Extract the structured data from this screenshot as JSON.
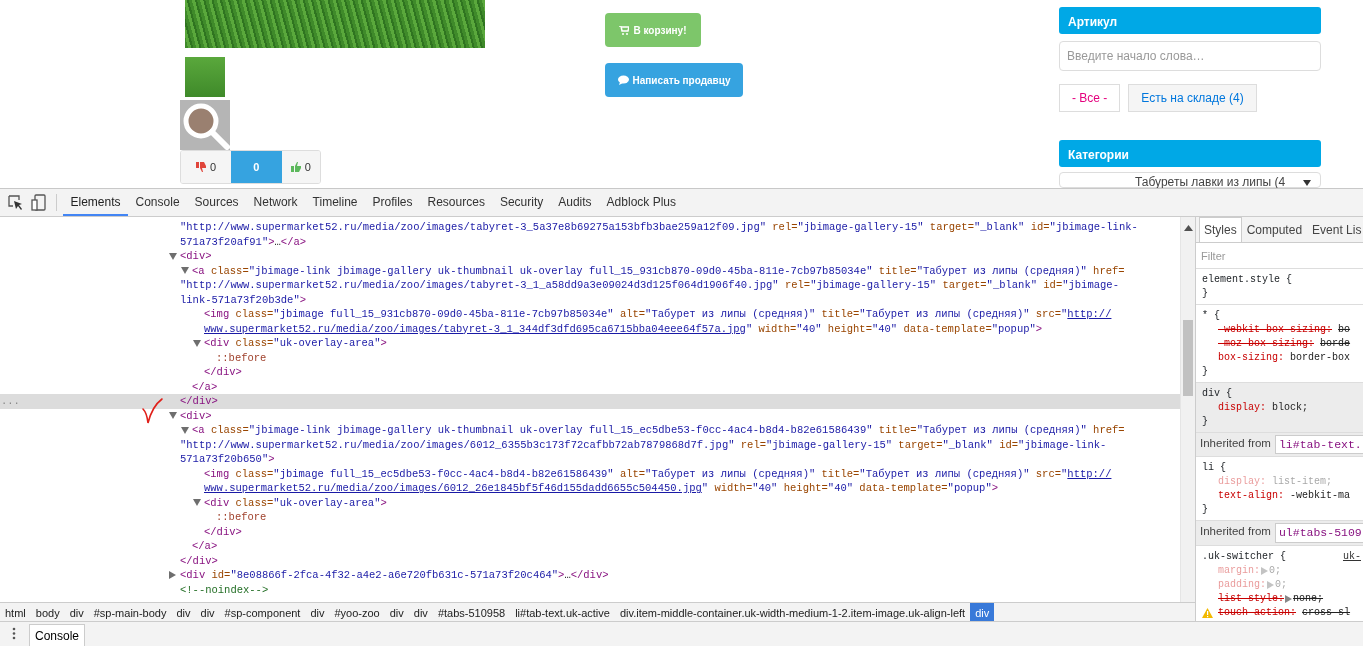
{
  "page": {
    "votes": [
      {
        "kind": "down",
        "count": "0"
      },
      {
        "kind": "score",
        "count": "0"
      },
      {
        "kind": "up",
        "count": "0"
      }
    ],
    "actions": [
      {
        "kind": "cart",
        "label": "В корзину!"
      },
      {
        "kind": "message",
        "label": "Написать продавцу"
      }
    ],
    "sidebar": {
      "sku_title": "Артикул",
      "sku_search": {
        "placeholder": "Введите начало слова…"
      },
      "filters": [
        {
          "label": "- Все -",
          "selected": true
        },
        {
          "label": "Есть на складе (4)",
          "selected": false
        }
      ],
      "categories_title": "Категории",
      "category_select": {
        "value": "Табуреты лавки из липы (4"
      }
    }
  },
  "devtools": {
    "tabs": [
      {
        "label": "Elements",
        "selected": true
      },
      {
        "label": "Console",
        "selected": false
      },
      {
        "label": "Sources",
        "selected": false
      },
      {
        "label": "Network",
        "selected": false
      },
      {
        "label": "Timeline",
        "selected": false
      },
      {
        "label": "Profiles",
        "selected": false
      },
      {
        "label": "Resources",
        "selected": false
      },
      {
        "label": "Security",
        "selected": false
      },
      {
        "label": "Audits",
        "selected": false
      },
      {
        "label": "Adblock Plus",
        "selected": false
      }
    ],
    "dom": {
      "selected_marker": "...",
      "nodes": [
        {
          "selected": false,
          "lines": [
            [
              {
                "kind": "value",
                "text": "\"http://www.supermarket52.ru/media/zoo/images/tabyret-3_5a37e8b69275a153bfb3bae259a12f09.jpg\""
              },
              {
                "kind": "attr",
                "text": " rel="
              },
              {
                "kind": "value",
                "text": "\"jbimage-gallery-15\""
              },
              {
                "kind": "attr",
                "text": " target="
              },
              {
                "kind": "value",
                "text": "\"_blank\""
              },
              {
                "kind": "attr",
                "text": " id="
              },
              {
                "kind": "value",
                "text": "\"jbimage-link-"
              }
            ],
            [
              {
                "kind": "value",
                "text": "571a73f20af91\""
              },
              {
                "kind": "tag",
                "text": ">"
              },
              {
                "kind": "plain",
                "text": "…"
              },
              {
                "kind": "tag",
                "text": "</a>"
              }
            ]
          ]
        },
        {
          "expanded": true,
          "selected": true,
          "lines": [
            [
              {
                "kind": "tag",
                "text": "<div>"
              }
            ]
          ],
          "close": [
            {
              "kind": "tag",
              "text": "</div>"
            }
          ],
          "children": [
            {
              "expanded": true,
              "selected": false,
              "lines": [
                [
                  {
                    "kind": "tag",
                    "text": "<a"
                  },
                  {
                    "kind": "attr",
                    "text": " class="
                  },
                  {
                    "kind": "value",
                    "text": "\"jbimage-link jbimage-gallery uk-thumbnail uk-overlay full_15_931cb870-09d0-45ba-811e-7cb97b85034e\""
                  },
                  {
                    "kind": "attr",
                    "text": " title="
                  },
                  {
                    "kind": "value",
                    "text": "\"Табурет из липы (средняя)\""
                  },
                  {
                    "kind": "attr",
                    "text": " href="
                  }
                ],
                [
                  {
                    "kind": "value",
                    "text": "\"http://www.supermarket52.ru/media/zoo/images/tabyret-3_1_a58dd9a3e09024d3d125f064d1906f40.jpg\""
                  },
                  {
                    "kind": "attr",
                    "text": " rel="
                  },
                  {
                    "kind": "value",
                    "text": "\"jbimage-gallery-15\""
                  },
                  {
                    "kind": "attr",
                    "text": " target="
                  },
                  {
                    "kind": "value",
                    "text": "\"_blank\""
                  },
                  {
                    "kind": "attr",
                    "text": " id="
                  },
                  {
                    "kind": "value",
                    "text": "\"jbimage-"
                  }
                ],
                [
                  {
                    "kind": "value",
                    "text": "link-571a73f20b3de\""
                  },
                  {
                    "kind": "tag",
                    "text": ">"
                  }
                ]
              ],
              "close": [
                {
                  "kind": "tag",
                  "text": "</a>"
                }
              ],
              "children": [
                {
                  "selected": false,
                  "lines": [
                    [
                      {
                        "kind": "tag",
                        "text": "<img"
                      },
                      {
                        "kind": "attr",
                        "text": " class="
                      },
                      {
                        "kind": "value",
                        "text": "\"jbimage full_15_931cb870-09d0-45ba-811e-7cb97b85034e\""
                      },
                      {
                        "kind": "attr",
                        "text": " alt="
                      },
                      {
                        "kind": "value",
                        "text": "\"Табурет из липы (средняя)\""
                      },
                      {
                        "kind": "attr",
                        "text": " title="
                      },
                      {
                        "kind": "value",
                        "text": "\"Табурет из липы (средняя)\""
                      },
                      {
                        "kind": "attr",
                        "text": " src="
                      },
                      {
                        "kind": "value",
                        "text": "\""
                      },
                      {
                        "kind": "link",
                        "text": "http://"
                      }
                    ],
                    [
                      {
                        "kind": "link",
                        "text": "www.supermarket52.ru/media/zoo/images/tabyret-3_1_344df3dfd695ca6715bba04eee64f57a.jpg"
                      },
                      {
                        "kind": "value",
                        "text": "\""
                      },
                      {
                        "kind": "attr",
                        "text": " width="
                      },
                      {
                        "kind": "value",
                        "text": "\"40\""
                      },
                      {
                        "kind": "attr",
                        "text": " height="
                      },
                      {
                        "kind": "value",
                        "text": "\"40\""
                      },
                      {
                        "kind": "attr",
                        "text": " data-template="
                      },
                      {
                        "kind": "value",
                        "text": "\"popup\""
                      },
                      {
                        "kind": "tag",
                        "text": ">"
                      }
                    ]
                  ]
                },
                {
                  "expanded": true,
                  "selected": false,
                  "lines": [
                    [
                      {
                        "kind": "tag",
                        "text": "<div"
                      },
                      {
                        "kind": "attr",
                        "text": " class="
                      },
                      {
                        "kind": "value",
                        "text": "\"uk-overlay-area\""
                      },
                      {
                        "kind": "tag",
                        "text": ">"
                      }
                    ]
                  ],
                  "close": [
                    {
                      "kind": "tag",
                      "text": "</div>"
                    }
                  ],
                  "children": [
                    {
                      "selected": false,
                      "lines": [
                        [
                          {
                            "kind": "pseudo",
                            "text": "::before"
                          }
                        ]
                      ]
                    }
                  ]
                }
              ]
            }
          ]
        },
        {
          "expanded": true,
          "selected": false,
          "lines": [
            [
              {
                "kind": "tag",
                "text": "<div>"
              }
            ]
          ],
          "close": [
            {
              "kind": "tag",
              "text": "</div>"
            }
          ],
          "children": [
            {
              "expanded": true,
              "selected": false,
              "lines": [
                [
                  {
                    "kind": "tag",
                    "text": "<a"
                  },
                  {
                    "kind": "attr",
                    "text": " class="
                  },
                  {
                    "kind": "value",
                    "text": "\"jbimage-link jbimage-gallery uk-thumbnail uk-overlay full_15_ec5dbe53-f0cc-4ac4-b8d4-b82e61586439\""
                  },
                  {
                    "kind": "attr",
                    "text": " title="
                  },
                  {
                    "kind": "value",
                    "text": "\"Табурет из липы (средняя)\""
                  },
                  {
                    "kind": "attr",
                    "text": " href="
                  }
                ],
                [
                  {
                    "kind": "value",
                    "text": "\"http://www.supermarket52.ru/media/zoo/images/6012_6355b3c173f72cafbb72ab7879868d7f.jpg\""
                  },
                  {
                    "kind": "attr",
                    "text": " rel="
                  },
                  {
                    "kind": "value",
                    "text": "\"jbimage-gallery-15\""
                  },
                  {
                    "kind": "attr",
                    "text": " target="
                  },
                  {
                    "kind": "value",
                    "text": "\"_blank\""
                  },
                  {
                    "kind": "attr",
                    "text": " id="
                  },
                  {
                    "kind": "value",
                    "text": "\"jbimage-link-"
                  }
                ],
                [
                  {
                    "kind": "value",
                    "text": "571a73f20b650\""
                  },
                  {
                    "kind": "tag",
                    "text": ">"
                  }
                ]
              ],
              "close": [
                {
                  "kind": "tag",
                  "text": "</a>"
                }
              ],
              "children": [
                {
                  "selected": false,
                  "lines": [
                    [
                      {
                        "kind": "tag",
                        "text": "<img"
                      },
                      {
                        "kind": "attr",
                        "text": " class="
                      },
                      {
                        "kind": "value",
                        "text": "\"jbimage full_15_ec5dbe53-f0cc-4ac4-b8d4-b82e61586439\""
                      },
                      {
                        "kind": "attr",
                        "text": " alt="
                      },
                      {
                        "kind": "value",
                        "text": "\"Табурет из липы (средняя)\""
                      },
                      {
                        "kind": "attr",
                        "text": " title="
                      },
                      {
                        "kind": "value",
                        "text": "\"Табурет из липы (средняя)\""
                      },
                      {
                        "kind": "attr",
                        "text": " src="
                      },
                      {
                        "kind": "value",
                        "text": "\""
                      },
                      {
                        "kind": "link",
                        "text": "http://"
                      }
                    ],
                    [
                      {
                        "kind": "link",
                        "text": "www.supermarket52.ru/media/zoo/images/6012_26e1845bf5f46d155dadd6655c504450.jpg"
                      },
                      {
                        "kind": "value",
                        "text": "\""
                      },
                      {
                        "kind": "attr",
                        "text": " width="
                      },
                      {
                        "kind": "value",
                        "text": "\"40\""
                      },
                      {
                        "kind": "attr",
                        "text": " height="
                      },
                      {
                        "kind": "value",
                        "text": "\"40\""
                      },
                      {
                        "kind": "attr",
                        "text": " data-template="
                      },
                      {
                        "kind": "value",
                        "text": "\"popup\""
                      },
                      {
                        "kind": "tag",
                        "text": ">"
                      }
                    ]
                  ]
                },
                {
                  "expanded": true,
                  "selected": false,
                  "lines": [
                    [
                      {
                        "kind": "tag",
                        "text": "<div"
                      },
                      {
                        "kind": "attr",
                        "text": " class="
                      },
                      {
                        "kind": "value",
                        "text": "\"uk-overlay-area\""
                      },
                      {
                        "kind": "tag",
                        "text": ">"
                      }
                    ]
                  ],
                  "close": [
                    {
                      "kind": "tag",
                      "text": "</div>"
                    }
                  ],
                  "children": [
                    {
                      "selected": false,
                      "lines": [
                        [
                          {
                            "kind": "pseudo",
                            "text": "::before"
                          }
                        ]
                      ]
                    }
                  ]
                }
              ]
            }
          ]
        },
        {
          "expanded": false,
          "selected": false,
          "lines": [
            [
              {
                "kind": "tag",
                "text": "<div"
              },
              {
                "kind": "attr",
                "text": " id="
              },
              {
                "kind": "value",
                "text": "\"8e08866f-2fca-4f32-a4e2-a6e720fb631c-571a73f20c464\""
              },
              {
                "kind": "tag",
                "text": ">"
              },
              {
                "kind": "plain",
                "text": "…"
              },
              {
                "kind": "tag",
                "text": "</div>"
              }
            ]
          ]
        },
        {
          "selected": false,
          "lines": [
            [
              {
                "kind": "comment",
                "text": "<!--noindex-->"
              }
            ]
          ]
        }
      ]
    },
    "breadcrumbs": [
      {
        "label": "html",
        "selected": false
      },
      {
        "label": "body",
        "selected": false
      },
      {
        "label": "div",
        "selected": false
      },
      {
        "label": "#sp-main-body",
        "selected": false
      },
      {
        "label": "div",
        "selected": false
      },
      {
        "label": "div",
        "selected": false
      },
      {
        "label": "#sp-component",
        "selected": false
      },
      {
        "label": "div",
        "selected": false
      },
      {
        "label": "#yoo-zoo",
        "selected": false
      },
      {
        "label": "div",
        "selected": false
      },
      {
        "label": "div",
        "selected": false
      },
      {
        "label": "#tabs-510958",
        "selected": false
      },
      {
        "label": "li#tab-text.uk-active",
        "selected": false
      },
      {
        "label": "div.item-middle-container.uk-width-medium-1-2.item-image.uk-align-left",
        "selected": false
      },
      {
        "label": "div",
        "selected": true
      }
    ],
    "styles": {
      "tabs": [
        {
          "label": "Styles",
          "selected": true
        },
        {
          "label": "Computed",
          "selected": false
        },
        {
          "label": "Event Lis",
          "selected": false
        }
      ],
      "filter": {
        "placeholder": "Filter"
      },
      "sections": [
        {
          "kind": "rule",
          "shaded": false,
          "selector": "element.style {",
          "close": "}"
        },
        {
          "kind": "rule",
          "shaded": false,
          "selector": "* {",
          "close": "}",
          "properties": [
            {
              "name": "-webkit-box-sizing:",
              "value": "bo",
              "overridden": true,
              "inactive": false
            },
            {
              "name": "-moz-box-sizing:",
              "value": "borde",
              "overridden": true,
              "inactive": false
            },
            {
              "name": "box-sizing:",
              "value": "border-box",
              "overridden": false,
              "inactive": false
            }
          ]
        },
        {
          "kind": "rule",
          "shaded": true,
          "selector": "div {",
          "close": "}",
          "properties": [
            {
              "name": "display:",
              "value": "block;",
              "overridden": false,
              "inactive": false
            }
          ]
        },
        {
          "kind": "inherited",
          "label": "Inherited from",
          "target": "li#tab-text."
        },
        {
          "kind": "rule",
          "shaded": false,
          "selector": "li {",
          "close": "}",
          "properties": [
            {
              "name": "display:",
              "value": "list-item;",
              "overridden": false,
              "inactive": true
            },
            {
              "name": "text-align:",
              "value": "-webkit-ma",
              "overridden": false,
              "inactive": false
            }
          ]
        },
        {
          "kind": "inherited",
          "label": "Inherited from",
          "target": "ul#tabs-5109"
        },
        {
          "kind": "rule",
          "shaded": false,
          "selector": ".uk-switcher {",
          "source": "uk-",
          "properties": [
            {
              "name": "margin:",
              "value": "0;",
              "overridden": false,
              "inactive": true,
              "shorthand": true
            },
            {
              "name": "padding:",
              "value": "0;",
              "overridden": false,
              "inactive": true,
              "shorthand": true
            },
            {
              "name": "list-style:",
              "value": "none;",
              "overridden": true,
              "inactive": false,
              "shorthand": true
            },
            {
              "name": "touch-action:",
              "value": "cross-sl",
              "overridden": true,
              "inactive": false,
              "warning": true
            }
          ]
        }
      ]
    },
    "drawer": {
      "tabs": [
        {
          "label": "Console",
          "selected": true
        }
      ]
    }
  }
}
